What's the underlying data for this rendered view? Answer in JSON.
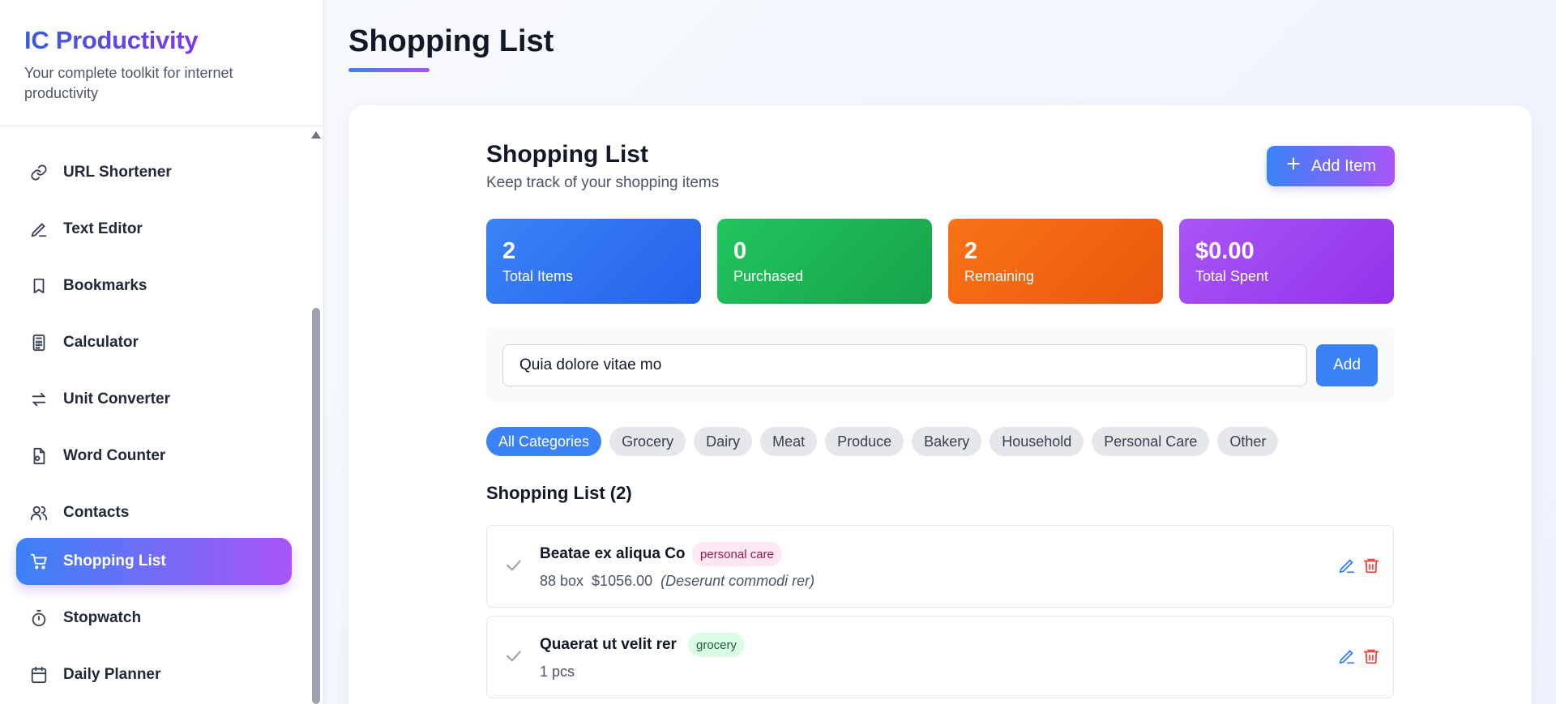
{
  "sidebar": {
    "brand_title": "IC Productivity",
    "brand_subtitle": "Your complete toolkit for internet productivity",
    "items": [
      {
        "label": "URL Shortener",
        "icon": "link-icon"
      },
      {
        "label": "Text Editor",
        "icon": "pencil-icon"
      },
      {
        "label": "Bookmarks",
        "icon": "bookmark-icon"
      },
      {
        "label": "Calculator",
        "icon": "calculator-icon"
      },
      {
        "label": "Unit Converter",
        "icon": "arrows-exchange-icon"
      },
      {
        "label": "Word Counter",
        "icon": "document-count-icon"
      },
      {
        "label": "Contacts",
        "icon": "users-icon"
      },
      {
        "label": "Shopping List",
        "icon": "cart-icon",
        "active": true
      },
      {
        "label": "Stopwatch",
        "icon": "timer-icon"
      },
      {
        "label": "Daily Planner",
        "icon": "calendar-icon"
      }
    ]
  },
  "page": {
    "title": "Shopping List"
  },
  "panel": {
    "title": "Shopping List",
    "subtitle": "Keep track of your shopping items",
    "add_item_label": "Add Item"
  },
  "stats": [
    {
      "value": "2",
      "label": "Total Items"
    },
    {
      "value": "0",
      "label": "Purchased"
    },
    {
      "value": "2",
      "label": "Remaining"
    },
    {
      "value": "$0.00",
      "label": "Total Spent"
    }
  ],
  "entry": {
    "value": "Quia dolore vitae mo",
    "add_label": "Add"
  },
  "categories": [
    "All Categories",
    "Grocery",
    "Dairy",
    "Meat",
    "Produce",
    "Bakery",
    "Household",
    "Personal Care",
    "Other"
  ],
  "active_category": "All Categories",
  "list": {
    "title": "Shopping List (2)",
    "items": [
      {
        "name": "Beatae ex aliqua Co",
        "tag": "personal care",
        "qty": "88 box",
        "price": "$1056.00",
        "note": "(Deserunt commodi rer)"
      },
      {
        "name": "Quaerat ut velit rer",
        "tag": "grocery",
        "qty": "1 pcs",
        "price": "",
        "note": ""
      }
    ]
  },
  "colors": {
    "accent_blue": "#3b82f6",
    "accent_purple": "#a855f7",
    "stat_green": "#22c55e",
    "stat_orange": "#f97316",
    "delete_red": "#ef4444"
  }
}
